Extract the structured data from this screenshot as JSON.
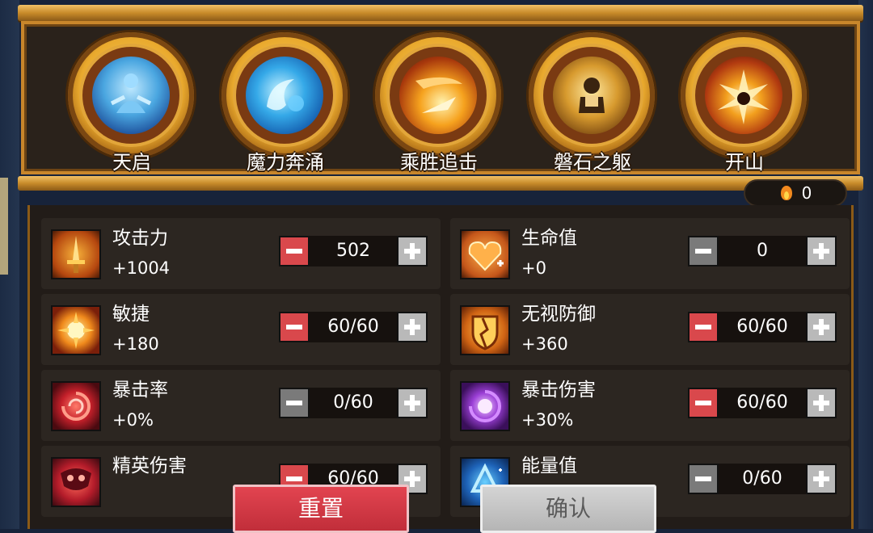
{
  "skills": [
    {
      "label": "天启",
      "icon": "meditating-figure-icon"
    },
    {
      "label": "魔力奔涌",
      "icon": "water-surge-icon"
    },
    {
      "label": "乘胜追击",
      "icon": "fire-slash-icon"
    },
    {
      "label": "磐石之躯",
      "icon": "stone-body-icon"
    },
    {
      "label": "开山",
      "icon": "explosion-icon"
    }
  ],
  "points": {
    "value": "0",
    "icon": "flame-icon"
  },
  "stats": [
    {
      "name": "攻击力",
      "bonus": "+1004",
      "value": "502",
      "icon": "sword-icon",
      "minus_active": true
    },
    {
      "name": "生命值",
      "bonus": "+0",
      "value": "0",
      "icon": "heart-icon",
      "minus_active": false
    },
    {
      "name": "敏捷",
      "bonus": "+180",
      "value": "60/60",
      "icon": "sun-burst-icon",
      "minus_active": true
    },
    {
      "name": "无视防御",
      "bonus": "+360",
      "value": "60/60",
      "icon": "broken-shield-icon",
      "minus_active": true
    },
    {
      "name": "暴击率",
      "bonus": "+0%",
      "value": "0/60",
      "icon": "red-vortex-icon",
      "minus_active": false
    },
    {
      "name": "暴击伤害",
      "bonus": "+30%",
      "value": "60/60",
      "icon": "purple-vortex-icon",
      "minus_active": true
    },
    {
      "name": "精英伤害",
      "bonus": "",
      "value": "60/60",
      "icon": "elite-mask-icon",
      "minus_active": true
    },
    {
      "name": "能量值",
      "bonus": "",
      "value": "0/60",
      "icon": "energy-triangle-icon",
      "minus_active": false
    }
  ],
  "buttons": {
    "reset": "重置",
    "confirm": "确认"
  },
  "colors": {
    "gold": "#e9a92d",
    "red_button": "#d9484c",
    "panel": "#2c2621"
  }
}
